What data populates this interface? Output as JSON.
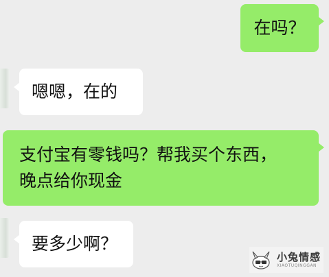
{
  "messages": [
    {
      "side": "out",
      "text": "在吗？"
    },
    {
      "side": "in",
      "text": "嗯嗯，在的"
    },
    {
      "side": "out",
      "line1": "支付宝有零钱吗？帮我买个东西，",
      "line2": "晚点给你现金"
    },
    {
      "side": "in",
      "text": "要多少啊？"
    }
  ],
  "watermark": {
    "title": "小兔情感",
    "subtitle": "XIAOTUQINGGAN"
  },
  "colors": {
    "background": "#ededed",
    "outgoing_bubble": "#95ec69",
    "incoming_bubble": "#ffffff"
  }
}
